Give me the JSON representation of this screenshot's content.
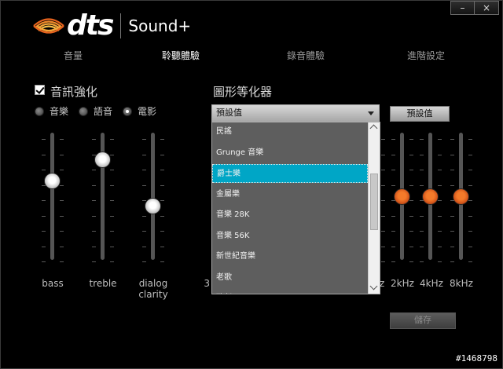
{
  "window": {
    "minimize_label": "–",
    "close_label": "×"
  },
  "logo": {
    "brand": "dts",
    "product": "Sound+"
  },
  "tabs": [
    {
      "label": "音量",
      "active": false
    },
    {
      "label": "聆聽體驗",
      "active": true
    },
    {
      "label": "錄音體驗",
      "active": false
    },
    {
      "label": "進階設定",
      "active": false
    }
  ],
  "enhancement": {
    "label": "音訊強化",
    "checked": true,
    "modes": [
      {
        "label": "音樂",
        "selected": false
      },
      {
        "label": "語音",
        "selected": false
      },
      {
        "label": "電影",
        "selected": true
      }
    ]
  },
  "sliders": [
    {
      "label_line1": "bass",
      "label_line2": "",
      "level": 0.64
    },
    {
      "label_line1": "treble",
      "label_line2": "",
      "level": 0.83
    },
    {
      "label_line1": "dialog",
      "label_line2": "clarity",
      "level": 0.41
    }
  ],
  "equalizer": {
    "title": "圖形等化器",
    "preset_value": "預設值",
    "reset_label": "預設值",
    "save_label": "儲存",
    "save_enabled": false,
    "dropdown_items": [
      "民謠",
      "Grunge 音樂",
      "爵士樂",
      "金屬樂",
      "音樂 28K",
      "音樂 56K",
      "新世紀音樂",
      "老歌",
      "歌劇"
    ],
    "dropdown_selected_index": 2,
    "partial_label": "3",
    "edge_label": "z",
    "bands": [
      {
        "label": "2kHz",
        "level": 0.5
      },
      {
        "label": "4kHz",
        "level": 0.5
      },
      {
        "label": "8kHz",
        "level": 0.5
      }
    ]
  },
  "colors": {
    "accent_selection": "#00a6c6",
    "knob_orange": "#e8641e"
  },
  "watermark": "#1468798"
}
